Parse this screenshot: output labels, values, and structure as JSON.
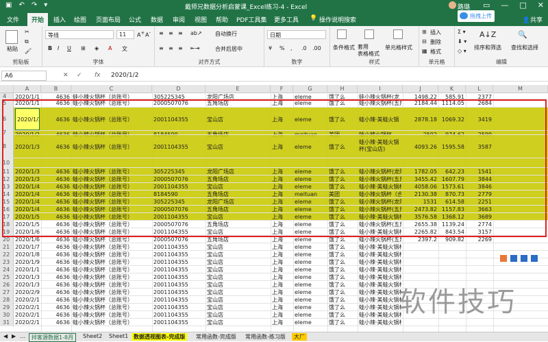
{
  "titlebar": {
    "title": "戴师兄数据分析启蒙课_Excel练习-4  -  Excel",
    "user": "路璐",
    "save_icon": "save-icon",
    "undo_icon": "undo-icon",
    "redo_icon": "redo-icon"
  },
  "tabs": {
    "items": [
      "文件",
      "开始",
      "插入",
      "绘图",
      "页面布局",
      "公式",
      "数据",
      "审阅",
      "视图",
      "帮助",
      "PDF工具集",
      "更多工具"
    ],
    "search": "操作说明搜索",
    "share": "共享",
    "cloud": "拖拽上传"
  },
  "ribbon": {
    "paste": "粘贴",
    "clipboard": "剪贴板",
    "font_name": "等线",
    "font_size": "11",
    "font": "字体",
    "wrap": "自动换行",
    "merge": "合并后居中",
    "alignment": "对齐方式",
    "numfmt": "日期",
    "number": "数字",
    "condfmt": "条件格式",
    "tablefmt": "套用\n表格格式",
    "cellstyle": "单元格样式",
    "styles": "样式",
    "insert": "插入",
    "delete": "删除",
    "format": "格式",
    "cells": "单元格",
    "sortfilter": "排序和筛选",
    "findselect": "查找和选择",
    "editing": "编辑"
  },
  "formula": {
    "namebox": "A6",
    "fx": "fx",
    "value": "2020/1/2"
  },
  "columns": [
    "A",
    "B",
    "C",
    "D",
    "E",
    "F",
    "G",
    "H",
    "I",
    "J",
    "K",
    "L",
    "M"
  ],
  "rows": [
    {
      "n": "4",
      "a": "2020/1/1",
      "b": "4636",
      "c": "蛙小辣火锅杯（总账号）",
      "d": "305225345",
      "e": "龙阳广场店",
      "f": "上海",
      "g": "eleme",
      "h": "饿了么",
      "i": "蛙小辣火锅杯(龙",
      "j": "1498.22",
      "k": "585.91",
      "l": "2377"
    },
    {
      "n": "5",
      "a": "2020/1/1",
      "b": "4636",
      "c": "蛙小辣火锅杯（总账号）",
      "d": "2000507076",
      "e": "五角场店",
      "f": "上海",
      "g": "eleme",
      "h": "饿了么",
      "i": "蛙小辣火锅杯(五角",
      "j": "2184.44",
      "k": "1114.05",
      "l": "2684"
    },
    {
      "n": "6",
      "a": "2020/1/2",
      "b": "4636",
      "c": "蛙小辣火锅杯（总账号）",
      "d": "2001104355",
      "e": "宝山店",
      "f": "上海",
      "g": "eleme",
      "h": "饿了么",
      "i": "蛙小辣·美蛙火锅",
      "j": "2878.18",
      "k": "1069.32",
      "l": "3419"
    },
    {
      "n": "7",
      "a": "2020/1/2",
      "b": "4636",
      "c": "蛙小辣火锅杯（总账号）",
      "d": "8184590",
      "e": "五角场店",
      "f": "上海",
      "g": "meituan",
      "h": "美团",
      "i": "蛙小辣火锅杯",
      "j": "2592",
      "k": "974.62",
      "l": "2599"
    },
    {
      "n": "8",
      "a": "2020/1/3",
      "b": "4636",
      "c": "蛙小辣火锅杯（总账号）",
      "d": "2001104355",
      "e": "宝山店",
      "f": "上海",
      "g": "eleme",
      "h": "饿了么",
      "i": "蛙小辣·美蛙火锅杯(宝山店)",
      "j": "4093.26",
      "k": "1595.58",
      "l": "3587"
    },
    {
      "n": "10",
      "a": "",
      "b": "",
      "c": "",
      "d": "",
      "e": "",
      "f": "",
      "g": "",
      "h": "",
      "i": "",
      "j": "",
      "k": "",
      "l": ""
    },
    {
      "n": "11",
      "a": "2020/1/3",
      "b": "4636",
      "c": "蛙小辣火锅杯（总账号）",
      "d": "305225345",
      "e": "龙阳广场店",
      "f": "上海",
      "g": "eleme",
      "h": "饿了么",
      "i": "蛙小辣火锅杯(龙阳",
      "j": "1782.05",
      "k": "642.23",
      "l": "1541"
    },
    {
      "n": "12",
      "a": "2020/1/3",
      "b": "4636",
      "c": "蛙小辣火锅杯（总账号）",
      "d": "2000507076",
      "e": "五角场店",
      "f": "上海",
      "g": "eleme",
      "h": "饿了么",
      "i": "蛙小辣火锅杯(五角",
      "j": "3455.42",
      "k": "1607.79",
      "l": "3844"
    },
    {
      "n": "13",
      "a": "2020/1/4",
      "b": "4636",
      "c": "蛙小辣火锅杯（总账号）",
      "d": "2001104355",
      "e": "宝山店",
      "f": "上海",
      "g": "eleme",
      "h": "饿了么",
      "i": "蛙小辣·美蛙火锅杯",
      "j": "4058.06",
      "k": "1573.61",
      "l": "3846"
    },
    {
      "n": "14",
      "a": "2020/1/4",
      "b": "4636",
      "c": "蛙小辣火锅杯（总账号）",
      "d": "8184590",
      "e": "五角场店",
      "f": "上海",
      "g": "meituan",
      "h": "美团",
      "i": "蛙小辣火锅杯（合",
      "j": "2130.38",
      "k": "870.73",
      "l": "2779"
    },
    {
      "n": "15",
      "a": "2020/1/4",
      "b": "4636",
      "c": "蛙小辣火锅杯（总账号）",
      "d": "305225345",
      "e": "龙阳广场店",
      "f": "上海",
      "g": "eleme",
      "h": "饿了么",
      "i": "蛙小辣火锅杯(龙阳",
      "j": "1531",
      "k": "614.58",
      "l": "2251"
    },
    {
      "n": "16",
      "a": "2020/1/4",
      "b": "4636",
      "c": "蛙小辣火锅杯（总账号）",
      "d": "2000507076",
      "e": "五角场店",
      "f": "上海",
      "g": "eleme",
      "h": "饿了么",
      "i": "蛙小辣火锅杯(五角",
      "j": "2473.82",
      "k": "1157.83",
      "l": "3663"
    },
    {
      "n": "17",
      "a": "2020/1/5",
      "b": "4636",
      "c": "蛙小辣火锅杯（总账号）",
      "d": "2001104355",
      "e": "宝山店",
      "f": "上海",
      "g": "eleme",
      "h": "饿了么",
      "i": "蛙小辣·美蛙火锅杯",
      "j": "3576.58",
      "k": "1368.12",
      "l": "3689"
    },
    {
      "n": "18",
      "a": "2020/1/5",
      "b": "4636",
      "c": "蛙小辣火锅杯（总账号）",
      "d": "2000507076",
      "e": "五角场店",
      "f": "上海",
      "g": "eleme",
      "h": "饿了么",
      "i": "蛙小辣火锅杯(五角",
      "j": "2655.38",
      "k": "1139.24",
      "l": "2774"
    },
    {
      "n": "19",
      "a": "2020/1/6",
      "b": "4636",
      "c": "蛙小辣火锅杯（总账号）",
      "d": "2001104355",
      "e": "宝山店",
      "f": "上海",
      "g": "eleme",
      "h": "饿了么",
      "i": "蛙小辣·美蛙火锅杯",
      "j": "2265.82",
      "k": "843.54",
      "l": "3157"
    },
    {
      "n": "20",
      "a": "2020/1/6",
      "b": "4636",
      "c": "蛙小辣火锅杯（总账号）",
      "d": "2000507076",
      "e": "五角场店",
      "f": "上海",
      "g": "eleme",
      "h": "饿了么",
      "i": "蛙小辣火锅杯(五角",
      "j": "2397.2",
      "k": "909.82",
      "l": "2269"
    },
    {
      "n": "21",
      "a": "2020/1/7",
      "b": "4636",
      "c": "蛙小辣火锅杯（总账号）",
      "d": "2001104355",
      "e": "宝山店",
      "f": "上海",
      "g": "eleme",
      "h": "饿了么",
      "i": "蛙小辣·美蛙火锅杯",
      "j": "",
      "k": "",
      "l": ""
    },
    {
      "n": "22",
      "a": "2020/1/8",
      "b": "4636",
      "c": "蛙小辣火锅杯（总账号）",
      "d": "2001104355",
      "e": "宝山店",
      "f": "上海",
      "g": "eleme",
      "h": "饿了么",
      "i": "蛙小辣·美蛙火锅杯",
      "j": "",
      "k": "",
      "l": ""
    },
    {
      "n": "23",
      "a": "2020/1/9",
      "b": "4636",
      "c": "蛙小辣火锅杯（总账号）",
      "d": "2001104355",
      "e": "宝山店",
      "f": "上海",
      "g": "eleme",
      "h": "饿了么",
      "i": "蛙小辣·美蛙火锅杯",
      "j": "",
      "k": "",
      "l": ""
    },
    {
      "n": "24",
      "a": "2020/1/10",
      "b": "4636",
      "c": "蛙小辣火锅杯（总账号）",
      "d": "2001104355",
      "e": "宝山店",
      "f": "上海",
      "g": "eleme",
      "h": "饿了么",
      "i": "蛙小辣·美蛙火锅杯",
      "j": "",
      "k": "",
      "l": ""
    },
    {
      "n": "25",
      "a": "2020/1/30",
      "b": "4636",
      "c": "蛙小辣火锅杯（总账号）",
      "d": "2001104355",
      "e": "宝山店",
      "f": "上海",
      "g": "eleme",
      "h": "饿了么",
      "i": "蛙小辣·美蛙火锅杯",
      "j": "",
      "k": "",
      "l": ""
    },
    {
      "n": "26",
      "a": "2020/1/31",
      "b": "4636",
      "c": "蛙小辣火锅杯（总账号）",
      "d": "2001104355",
      "e": "宝山店",
      "f": "上海",
      "g": "eleme",
      "h": "饿了么",
      "i": "蛙小辣·美蛙火锅杯",
      "j": "",
      "k": "",
      "l": ""
    },
    {
      "n": "27",
      "a": "2020/2/9",
      "b": "4636",
      "c": "蛙小辣火锅杯（总账号）",
      "d": "2001104355",
      "e": "宝山店",
      "f": "上海",
      "g": "eleme",
      "h": "饿了么",
      "i": "蛙小辣·美蛙火锅杯",
      "j": "",
      "k": "",
      "l": ""
    },
    {
      "n": "28",
      "a": "2020/2/10",
      "b": "4636",
      "c": "蛙小辣火锅杯（总账号）",
      "d": "2001104355",
      "e": "宝山店",
      "f": "上海",
      "g": "eleme",
      "h": "饿了么",
      "i": "蛙小辣·美蛙火锅杯",
      "j": "",
      "k": "",
      "l": ""
    },
    {
      "n": "29",
      "a": "2020/2/11",
      "b": "4636",
      "c": "蛙小辣火锅杯（总账号）",
      "d": "2001104355",
      "e": "宝山店",
      "f": "上海",
      "g": "eleme",
      "h": "饿了么",
      "i": "蛙小辣·美蛙火锅杯",
      "j": "",
      "k": "",
      "l": ""
    },
    {
      "n": "30",
      "a": "2020/2/12",
      "b": "4636",
      "c": "蛙小辣火锅杯（总账号）",
      "d": "2001104355",
      "e": "宝山店",
      "f": "上海",
      "g": "eleme",
      "h": "饿了么",
      "i": "蛙小辣·美蛙火锅杯",
      "j": "",
      "k": "",
      "l": ""
    },
    {
      "n": "31",
      "a": "2020/2/13",
      "b": "4636",
      "c": "蛙小辣火锅杯（总账号）",
      "d": "2001104355",
      "e": "宝山店",
      "f": "上海",
      "g": "eleme",
      "h": "饿了么",
      "i": "蛙小辣·美蛙火锅杯",
      "j": "",
      "k": "",
      "l": ""
    }
  ],
  "sheets": {
    "items": [
      "拌客源数据1-8月",
      "Sheet2",
      "Sheet1",
      "数据透视图表-完成版",
      "常用函数-完成版",
      "常用函数-练习版",
      "大厂"
    ],
    "active": 3
  },
  "watermark": "软件技巧",
  "colors": {
    "brand": "#217346",
    "highlight": "#c8c800",
    "selection": "#e02020"
  }
}
